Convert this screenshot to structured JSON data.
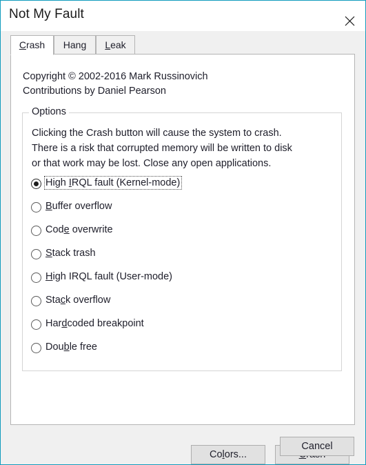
{
  "window": {
    "title": "Not My Fault",
    "close_icon": "close-icon",
    "border_color": "#0f9bbd",
    "titlebar_background": "#ffffff",
    "dialog_background": "#f0f0f0"
  },
  "tabs": [
    {
      "label": "Crash",
      "accel_index": 0,
      "active": true
    },
    {
      "label": "Hang",
      "accel_index": 3,
      "active": false
    },
    {
      "label": "Leak",
      "accel_index": 0,
      "active": false
    }
  ],
  "crash_page": {
    "copyright_line1": "Copyright © 2002-2016 Mark Russinovich",
    "copyright_line2": "Contributions by Daniel Pearson",
    "group": {
      "legend": "Options",
      "description_line1": "Clicking the Crash button will cause the system to crash.",
      "description_line2": "There is a risk that corrupted memory will be written to disk",
      "description_line3": "or that work may be lost. Close any open applications.",
      "options": [
        {
          "label": "High IRQL fault (Kernel-mode)",
          "accel_index": 5,
          "selected": true,
          "focused": true
        },
        {
          "label": "Buffer overflow",
          "accel_index": 0,
          "selected": false,
          "focused": false
        },
        {
          "label": "Code overwrite",
          "accel_index": 3,
          "selected": false,
          "focused": false
        },
        {
          "label": "Stack trash",
          "accel_index": 0,
          "selected": false,
          "focused": false
        },
        {
          "label": "High IRQL fault (User-mode)",
          "accel_index": 0,
          "selected": false,
          "focused": false
        },
        {
          "label": "Stack overflow",
          "accel_index": 3,
          "selected": false,
          "focused": false
        },
        {
          "label": "Hardcoded breakpoint",
          "accel_index": 3,
          "selected": false,
          "focused": false
        },
        {
          "label": "Double free",
          "accel_index": 3,
          "selected": false,
          "focused": false
        }
      ]
    }
  },
  "buttons": {
    "colors": {
      "label": "Colors...",
      "accel_index": 2
    },
    "crash": {
      "label": "Crash",
      "accel_index": 0
    },
    "cancel": {
      "label": "Cancel",
      "accel_index": -1
    }
  }
}
